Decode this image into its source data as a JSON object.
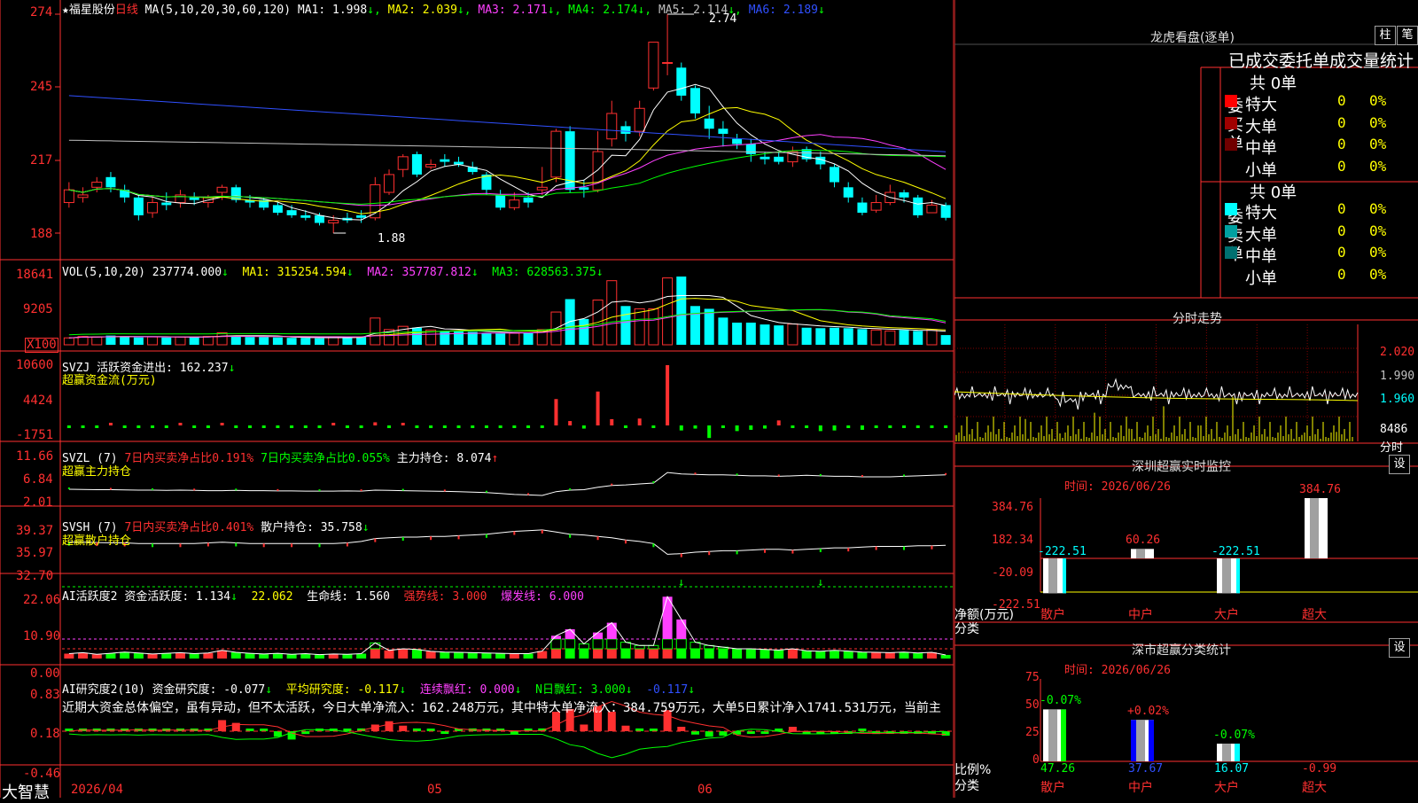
{
  "stock": {
    "name": "★福星股份",
    "period": "日线"
  },
  "kline": {
    "ma_prefix": "MA(5,10,20,30,60,120)",
    "ma": [
      {
        "label": "MA1: 1.998",
        "color": "#ffffff"
      },
      {
        "label": "MA2: 2.039",
        "color": "#ffff00"
      },
      {
        "label": "MA3: 2.171",
        "color": "#ff40ff"
      },
      {
        "label": "MA4: 2.174",
        "color": "#00ff00"
      },
      {
        "label": "MA5: 2.114",
        "color": "#c0c0c0"
      },
      {
        "label": "MA6: 2.189",
        "color": "#3050ff"
      }
    ],
    "arrow": "↓",
    "ticks": [
      "274",
      "245",
      "217",
      "188"
    ],
    "high": "2.74",
    "low": "1.88",
    "candles": [
      [
        2.0,
        2.05,
        2.08,
        1.98
      ],
      [
        2.02,
        2.03,
        2.06,
        2.0
      ],
      [
        2.06,
        2.08,
        2.1,
        2.04
      ],
      [
        2.1,
        2.06,
        2.12,
        2.04
      ],
      [
        2.05,
        2.02,
        2.07,
        2.0
      ],
      [
        2.02,
        1.95,
        2.03,
        1.93
      ],
      [
        1.96,
        2.0,
        2.02,
        1.94
      ],
      [
        2.0,
        1.99,
        2.04,
        1.97
      ],
      [
        2.0,
        2.03,
        2.05,
        1.98
      ],
      [
        2.02,
        2.01,
        2.04,
        1.99
      ],
      [
        2.0,
        2.02,
        2.03,
        1.98
      ],
      [
        2.04,
        2.06,
        2.07,
        2.01
      ],
      [
        2.06,
        2.01,
        2.07,
        2.0
      ],
      [
        2.01,
        2.0,
        2.03,
        1.98
      ],
      [
        2.01,
        1.98,
        2.02,
        1.97
      ],
      [
        1.99,
        1.96,
        2.0,
        1.95
      ],
      [
        1.97,
        1.95,
        1.99,
        1.94
      ],
      [
        1.95,
        1.94,
        1.97,
        1.93
      ],
      [
        1.95,
        1.92,
        1.96,
        1.91
      ],
      [
        1.92,
        1.93,
        1.95,
        1.88
      ],
      [
        1.94,
        1.93,
        1.96,
        1.92
      ],
      [
        1.95,
        1.94,
        1.97,
        1.92
      ],
      [
        1.94,
        2.07,
        2.1,
        1.93
      ],
      [
        2.04,
        2.11,
        2.13,
        2.03
      ],
      [
        2.13,
        2.18,
        2.19,
        2.1
      ],
      [
        2.19,
        2.11,
        2.2,
        2.1
      ],
      [
        2.14,
        2.15,
        2.17,
        2.13
      ],
      [
        2.17,
        2.16,
        2.19,
        2.14
      ],
      [
        2.16,
        2.15,
        2.18,
        2.14
      ],
      [
        2.14,
        2.12,
        2.16,
        2.11
      ],
      [
        2.11,
        2.05,
        2.12,
        2.03
      ],
      [
        2.03,
        1.98,
        2.05,
        1.97
      ],
      [
        1.98,
        2.01,
        2.04,
        1.97
      ],
      [
        2.02,
        2.0,
        2.04,
        1.98
      ],
      [
        2.05,
        2.06,
        2.14,
        2.03
      ],
      [
        2.1,
        2.28,
        2.29,
        2.08
      ],
      [
        2.28,
        2.05,
        2.3,
        2.04
      ],
      [
        2.06,
        2.05,
        2.09,
        2.02
      ],
      [
        2.05,
        2.2,
        2.28,
        2.04
      ],
      [
        2.25,
        2.35,
        2.4,
        2.22
      ],
      [
        2.3,
        2.27,
        2.32,
        2.24
      ],
      [
        2.28,
        2.37,
        2.4,
        2.26
      ],
      [
        2.45,
        2.63,
        2.63,
        2.44
      ],
      [
        2.55,
        2.55,
        2.74,
        2.5
      ],
      [
        2.53,
        2.42,
        2.55,
        2.4
      ],
      [
        2.45,
        2.35,
        2.46,
        2.33
      ],
      [
        2.33,
        2.29,
        2.38,
        2.25
      ],
      [
        2.29,
        2.27,
        2.32,
        2.22
      ],
      [
        2.25,
        2.23,
        2.27,
        2.21
      ],
      [
        2.23,
        2.19,
        2.25,
        2.16
      ],
      [
        2.18,
        2.17,
        2.2,
        2.15
      ],
      [
        2.18,
        2.16,
        2.2,
        2.15
      ],
      [
        2.16,
        2.2,
        2.22,
        2.14
      ],
      [
        2.21,
        2.17,
        2.22,
        2.16
      ],
      [
        2.18,
        2.15,
        2.2,
        2.13
      ],
      [
        2.14,
        2.08,
        2.15,
        2.06
      ],
      [
        2.06,
        2.02,
        2.08,
        2.0
      ],
      [
        2.0,
        1.96,
        2.02,
        1.95
      ],
      [
        1.97,
        2.0,
        2.03,
        1.96
      ],
      [
        2.0,
        2.04,
        2.07,
        1.99
      ],
      [
        2.04,
        2.02,
        2.05,
        2.0
      ],
      [
        2.02,
        1.95,
        2.03,
        1.94
      ],
      [
        1.96,
        1.99,
        2.01,
        1.96
      ],
      [
        1.99,
        1.94,
        2.0,
        1.93
      ]
    ]
  },
  "vol": {
    "prefix": "VOL(5,10,20)",
    "value": "237774.000",
    "ma1": "MA1: 315254.594",
    "ma2": "MA2: 357787.812",
    "ma3": "MA3: 628563.375",
    "ticks": [
      "18641",
      "9205"
    ],
    "unit": "X100",
    "values": [
      1500,
      1800,
      1700,
      2000,
      1800,
      1600,
      1700,
      1600,
      1700,
      1700,
      1800,
      2600,
      2000,
      1700,
      1700,
      1600,
      1500,
      1500,
      1400,
      1700,
      1600,
      1800,
      5800,
      3300,
      4000,
      3700,
      3200,
      3000,
      2900,
      2800,
      2600,
      2600,
      2500,
      2500,
      3300,
      7100,
      9900,
      5600,
      9700,
      13900,
      8400,
      7800,
      7800,
      14500,
      14800,
      8400,
      7800,
      5900,
      4800,
      4800,
      4400,
      4200,
      4500,
      3700,
      3600,
      3700,
      3600,
      3400,
      3200,
      3000,
      3200,
      3000,
      3300,
      2100
    ]
  },
  "svzj": {
    "prefix": "SVZJ",
    "active_label": "活跃资金进出: 162.237",
    "sub_label": "超赢资金流(万元)",
    "ticks": [
      "10600",
      "4424",
      "-1751"
    ],
    "values": [
      -50,
      -80,
      -60,
      100,
      -50,
      -90,
      -70,
      -40,
      120,
      -60,
      -30,
      180,
      -50,
      -80,
      -60,
      -40,
      -70,
      -50,
      -60,
      90,
      -40,
      -60,
      500,
      -120,
      160,
      -60,
      -200,
      -90,
      -200,
      -100,
      -400,
      -350,
      -200,
      -100,
      -60,
      4200,
      700,
      -500,
      5400,
      1000,
      -400,
      1100,
      -300,
      9600,
      -800,
      -500,
      -2000,
      -300,
      -900,
      -700,
      -500,
      800,
      -400,
      -300,
      -900,
      -800,
      -350,
      -700,
      -300,
      -200,
      -100,
      -70,
      -50,
      -40
    ]
  },
  "svzl": {
    "prefix": "SVZL (7)",
    "net_red": "7日内买卖净占比0.191%",
    "net_green": "7日内买卖净占比0.055%",
    "main": "主力持仓: 8.074",
    "sub_label": "超赢主力持仓",
    "ticks": [
      "11.66",
      "6.84",
      "2.01"
    ]
  },
  "svsh": {
    "prefix": "SVSH (7)",
    "net_red": "7日内买卖净占比0.401%",
    "retail": "散户持仓: 35.758",
    "sub_label": "超赢散户持仓",
    "ticks": [
      "39.37",
      "35.97",
      "32.70"
    ]
  },
  "ai1": {
    "prefix": "AI活跃度2",
    "active": "资金活跃度: 1.134",
    "v2": "22.062",
    "life": "生命线: 1.560",
    "strong": "强势线: 3.000",
    "burst": "爆发线: 6.000",
    "ticks": [
      "22.06",
      "10.90",
      "0.00"
    ],
    "values": [
      1.5,
      1.8,
      1.3,
      1.6,
      2,
      1.7,
      1.4,
      1.6,
      1.8,
      1.5,
      1.7,
      2.5,
      1.9,
      1.6,
      1.4,
      1.6,
      1.3,
      1.5,
      1.2,
      1.4,
      1.3,
      1.5,
      4.8,
      2.5,
      3.0,
      2.8,
      2.2,
      2.0,
      1.9,
      1.8,
      1.7,
      1.6,
      1.5,
      1.5,
      2.3,
      7.0,
      9.0,
      4.5,
      8.0,
      11.0,
      5.0,
      4.0,
      4.0,
      19.0,
      12.0,
      5.0,
      4.0,
      3.5,
      3.0,
      3.0,
      2.8,
      2.6,
      3.0,
      2.4,
      2.2,
      2.5,
      2.3,
      2.0,
      1.9,
      1.8,
      2.0,
      1.7,
      1.9,
      1.1
    ]
  },
  "ai2": {
    "prefix": "AI研究度2(10)",
    "research": "资金研究度: -0.077",
    "avg": "平均研究度: -0.117",
    "red": "连续飘红: 0.000",
    "n_red": "N日飘红: 3.000",
    "last": "-0.117",
    "comment": "近期大资金总体偏空，虽有异动，但不太活跃，今日大单净流入：162.248万元，其中特大单净流入：384.759万元，大单5日累计净入1741.531万元，当前主",
    "ticks": [
      "0.83",
      "0.18",
      "-0.46"
    ]
  },
  "bottom": {
    "brand": "大智慧",
    "date": "2026/04",
    "m05": "05",
    "m06": "06"
  },
  "lhb": {
    "title": "龙虎看盘(逐单)",
    "btn1": "柱",
    "btn2": "笔",
    "header": "已成交委托单成交量统计",
    "buy": {
      "side": "委买单",
      "total": "共 0单",
      "rows": [
        {
          "label": "特大",
          "n": "0",
          "p": "0%",
          "color": "#ff0000"
        },
        {
          "label": "大单",
          "n": "0",
          "p": "0%",
          "color": "#a00000"
        },
        {
          "label": "中单",
          "n": "0",
          "p": "0%",
          "color": "#700000"
        },
        {
          "label": "小单",
          "n": "0",
          "p": "0%",
          "color": "#000000"
        }
      ]
    },
    "sell": {
      "side": "委卖单",
      "total": "共 0单",
      "rows": [
        {
          "label": "特大",
          "n": "0",
          "p": "0%",
          "color": "#00ffff"
        },
        {
          "label": "大单",
          "n": "0",
          "p": "0%",
          "color": "#00a0a0"
        },
        {
          "label": "中单",
          "n": "0",
          "p": "0%",
          "color": "#007070"
        },
        {
          "label": "小单",
          "n": "0",
          "p": "0%",
          "color": "#000000"
        }
      ]
    }
  },
  "fenshi": {
    "title": "分时走势",
    "ticks": [
      "2.020",
      "1.990",
      "1.960"
    ],
    "vol": "8486",
    "vol_label": "分时"
  },
  "monitor": {
    "title": "深圳超赢实时监控",
    "btn": "设",
    "time": "时间: 2026/06/26",
    "ticks": [
      "384.76",
      "182.34",
      "-20.09",
      "-222.51"
    ],
    "ylabel1": "净额(万元)",
    "ylabel2": "分类",
    "cats": [
      "散户",
      "中户",
      "大户",
      "超大"
    ],
    "values": [
      -222.51,
      60.26,
      -222.51,
      384.76
    ],
    "value_labels": [
      "-222.51",
      "60.26",
      "-222.51",
      "384.76"
    ]
  },
  "classify": {
    "title": "深市超赢分类统计",
    "btn": "设",
    "time": "时间: 2026/06/26",
    "ticks": [
      "75",
      "50",
      "25",
      "0"
    ],
    "ylabel1": "比例%",
    "ylabel2": "分类",
    "cats": [
      "散户",
      "中户",
      "大户",
      "超大"
    ],
    "heights": [
      47.26,
      37.67,
      16.07,
      0
    ],
    "top_labels": [
      "-0.07%",
      "+0.02%",
      "-0.07%",
      ""
    ],
    "bottom_labels": [
      "47.26",
      "37.67",
      "16.07",
      "-0.99"
    ]
  }
}
